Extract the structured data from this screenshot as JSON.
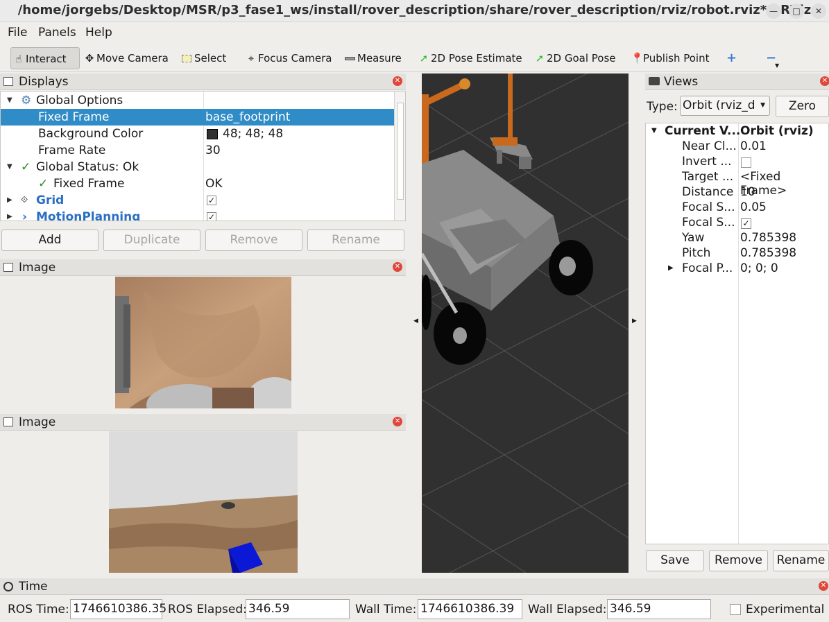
{
  "window": {
    "title": "/home/jorgebs/Desktop/MSR/p3_fase1_ws/install/rover_description/share/rover_description/rviz/robot.rviz* - RViz"
  },
  "menubar": {
    "file": "File",
    "panels": "Panels",
    "help": "Help"
  },
  "toolbar": {
    "interact": "Interact",
    "move_camera": "Move Camera",
    "select": "Select",
    "focus_camera": "Focus Camera",
    "measure": "Measure",
    "pose_estimate": "2D Pose Estimate",
    "goal_pose": "2D Goal Pose",
    "publish_point": "Publish Point",
    "plus": "+",
    "minus": "−"
  },
  "displays": {
    "title": "Displays",
    "rows": [
      {
        "name": "Global Options",
        "value": ""
      },
      {
        "name": "Fixed Frame",
        "value": "base_footprint"
      },
      {
        "name": "Background Color",
        "value": "48; 48; 48"
      },
      {
        "name": "Frame Rate",
        "value": "30"
      },
      {
        "name": "Global Status: Ok",
        "value": ""
      },
      {
        "name": "Fixed Frame",
        "value": "OK"
      },
      {
        "name": "Grid",
        "value": ""
      },
      {
        "name": "MotionPlanning",
        "value": ""
      }
    ],
    "background_color_hex": "#303030",
    "buttons": {
      "add": "Add",
      "duplicate": "Duplicate",
      "remove": "Remove",
      "rename": "Rename"
    }
  },
  "image_panels": [
    {
      "title": "Image"
    },
    {
      "title": "Image"
    }
  ],
  "views": {
    "title": "Views",
    "type_label": "Type:",
    "type_value": "Orbit (rviz_d",
    "zero": "Zero",
    "rows": [
      {
        "name": "Current V...",
        "value": "Orbit (rviz)"
      },
      {
        "name": "Near Cl...",
        "value": "0.01"
      },
      {
        "name": "Invert ...",
        "value": ""
      },
      {
        "name": "Target ...",
        "value": "<Fixed Frame>"
      },
      {
        "name": "Distance",
        "value": "10"
      },
      {
        "name": "Focal S...",
        "value": "0.05"
      },
      {
        "name": "Focal S...",
        "value": ""
      },
      {
        "name": "Yaw",
        "value": "0.785398"
      },
      {
        "name": "Pitch",
        "value": "0.785398"
      },
      {
        "name": "Focal P...",
        "value": "0; 0; 0"
      }
    ],
    "buttons": {
      "save": "Save",
      "remove": "Remove",
      "rename": "Rename"
    }
  },
  "time": {
    "title": "Time",
    "ros_time_label": "ROS Time:",
    "ros_time": "1746610386.35",
    "ros_elapsed_label": "ROS Elapsed:",
    "ros_elapsed": "346.59",
    "wall_time_label": "Wall Time:",
    "wall_time": "1746610386.39",
    "wall_elapsed_label": "Wall Elapsed:",
    "wall_elapsed": "346.59",
    "experimental": "Experimental"
  },
  "colors": {
    "selection": "#308cc6",
    "link_blue": "#2a6fc2",
    "viewport_bg": "#303030"
  }
}
